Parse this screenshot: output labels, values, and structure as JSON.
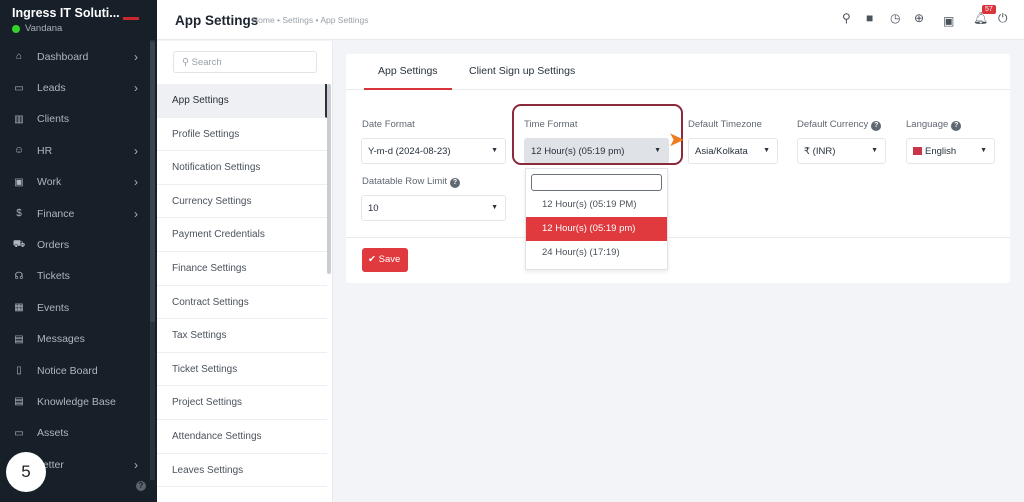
{
  "sidebar": {
    "company": "Ingress IT Soluti...",
    "user": "Vandana",
    "items": [
      {
        "label": "Dashboard",
        "icon": "home-icon",
        "chevron": true
      },
      {
        "label": "Leads",
        "icon": "id-card-icon",
        "chevron": true
      },
      {
        "label": "Clients",
        "icon": "building-icon",
        "chevron": false
      },
      {
        "label": "HR",
        "icon": "people-icon",
        "chevron": true
      },
      {
        "label": "Work",
        "icon": "briefcase-icon",
        "chevron": true
      },
      {
        "label": "Finance",
        "icon": "dollar-icon",
        "chevron": true
      },
      {
        "label": "Orders",
        "icon": "cart-icon",
        "chevron": false
      },
      {
        "label": "Tickets",
        "icon": "headset-icon",
        "chevron": false
      },
      {
        "label": "Events",
        "icon": "calendar-icon",
        "chevron": false
      },
      {
        "label": "Messages",
        "icon": "chat-icon",
        "chevron": false
      },
      {
        "label": "Notice Board",
        "icon": "clipboard-icon",
        "chevron": false
      },
      {
        "label": "Knowledge Base",
        "icon": "book-icon",
        "chevron": false
      },
      {
        "label": "Assets",
        "icon": "monitor-icon",
        "chevron": false
      },
      {
        "label": "Letter",
        "icon": "letter-icon",
        "chevron": true
      }
    ]
  },
  "step_marker": "5",
  "header": {
    "title": "App Settings",
    "breadcrumb": "Home • Settings • App Settings",
    "notification_count": "57"
  },
  "settings_menu": {
    "search_placeholder": "Search",
    "items": [
      "App Settings",
      "Profile Settings",
      "Notification Settings",
      "Currency Settings",
      "Payment Credentials",
      "Finance Settings",
      "Contract Settings",
      "Tax Settings",
      "Ticket Settings",
      "Project Settings",
      "Attendance Settings",
      "Leaves Settings"
    ]
  },
  "tabs": [
    "App Settings",
    "Client Sign up Settings"
  ],
  "form": {
    "date_format": {
      "label": "Date Format",
      "value": "Y-m-d (2024-08-23)"
    },
    "time_format": {
      "label": "Time Format",
      "value": "12 Hour(s) (05:19 pm)",
      "options": [
        "12 Hour(s) (05:19 PM)",
        "12 Hour(s) (05:19 pm)",
        "24 Hour(s) (17:19)"
      ]
    },
    "timezone": {
      "label": "Default Timezone",
      "value": "Asia/Kolkata"
    },
    "currency": {
      "label": "Default Currency",
      "value": "₹ (INR)"
    },
    "language": {
      "label": "Language",
      "value": "English"
    },
    "row_limit": {
      "label": "Datatable Row Limit",
      "value": "10"
    },
    "save": "Save"
  },
  "colors": {
    "accent": "#e03a3f",
    "sidebar": "#171f29",
    "highlight": "#8b2a3d"
  }
}
